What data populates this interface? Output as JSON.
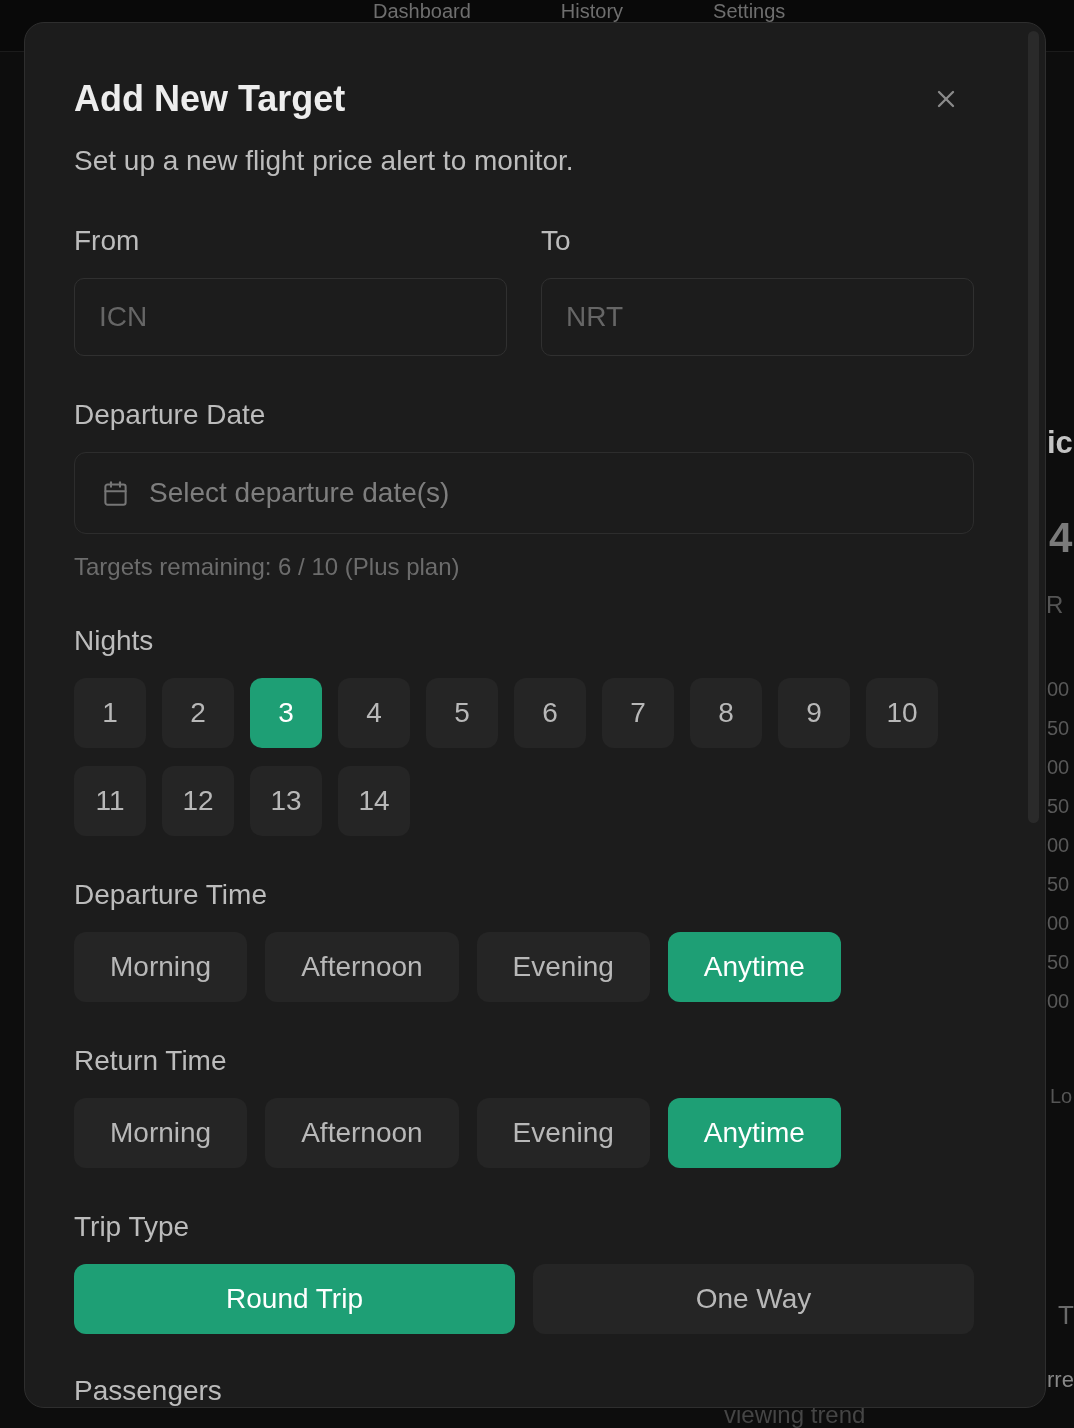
{
  "background": {
    "nav": [
      {
        "label": "Dashboard"
      },
      {
        "label": "History"
      },
      {
        "label": "Settings"
      }
    ],
    "side_fragments": [
      {
        "kind": "heading",
        "text": "ic"
      },
      {
        "kind": "figure",
        "text": "4"
      },
      {
        "kind": "caption",
        "text": "R"
      },
      {
        "kind": "tick",
        "text": "00"
      },
      {
        "kind": "tick",
        "text": "50"
      },
      {
        "kind": "tick",
        "text": "00"
      },
      {
        "kind": "tick",
        "text": "50"
      },
      {
        "kind": "tick",
        "text": "00"
      },
      {
        "kind": "tick",
        "text": "50"
      },
      {
        "kind": "tick",
        "text": "00"
      },
      {
        "kind": "tick",
        "text": "50"
      },
      {
        "kind": "tick",
        "text": "00"
      },
      {
        "kind": "legend",
        "text": "Lo"
      },
      {
        "kind": "title",
        "text": "T"
      },
      {
        "kind": "text",
        "text": "rre"
      }
    ],
    "footer_text": "viewing trend"
  },
  "dialog": {
    "title": "Add New Target",
    "subtitle": "Set up a new flight price alert to monitor.",
    "fields": [
      {
        "label": "From",
        "placeholder": "ICN"
      },
      {
        "label": "To",
        "placeholder": "NRT"
      }
    ],
    "departure_date": {
      "label": "Departure Date",
      "placeholder": "Select departure date(s)",
      "hint": "Targets remaining: 6 / 10 (Plus plan)"
    },
    "nights": {
      "label": "Nights",
      "options": [
        {
          "label": "1",
          "selected": false
        },
        {
          "label": "2",
          "selected": false
        },
        {
          "label": "3",
          "selected": true
        },
        {
          "label": "4",
          "selected": false
        },
        {
          "label": "5",
          "selected": false
        },
        {
          "label": "6",
          "selected": false
        },
        {
          "label": "7",
          "selected": false
        },
        {
          "label": "8",
          "selected": false
        },
        {
          "label": "9",
          "selected": false
        },
        {
          "label": "10",
          "selected": false
        },
        {
          "label": "11",
          "selected": false
        },
        {
          "label": "12",
          "selected": false
        },
        {
          "label": "13",
          "selected": false
        },
        {
          "label": "14",
          "selected": false
        }
      ]
    },
    "departure_time": {
      "label": "Departure Time",
      "options": [
        {
          "label": "Morning",
          "selected": false
        },
        {
          "label": "Afternoon",
          "selected": false
        },
        {
          "label": "Evening",
          "selected": false
        },
        {
          "label": "Anytime",
          "selected": true
        }
      ]
    },
    "return_time": {
      "label": "Return Time",
      "options": [
        {
          "label": "Morning",
          "selected": false
        },
        {
          "label": "Afternoon",
          "selected": false
        },
        {
          "label": "Evening",
          "selected": false
        },
        {
          "label": "Anytime",
          "selected": true
        }
      ]
    },
    "trip_type": {
      "label": "Trip Type",
      "options": [
        {
          "label": "Round Trip",
          "selected": true
        },
        {
          "label": "One Way",
          "selected": false
        }
      ]
    },
    "passengers": {
      "label": "Passengers"
    }
  }
}
